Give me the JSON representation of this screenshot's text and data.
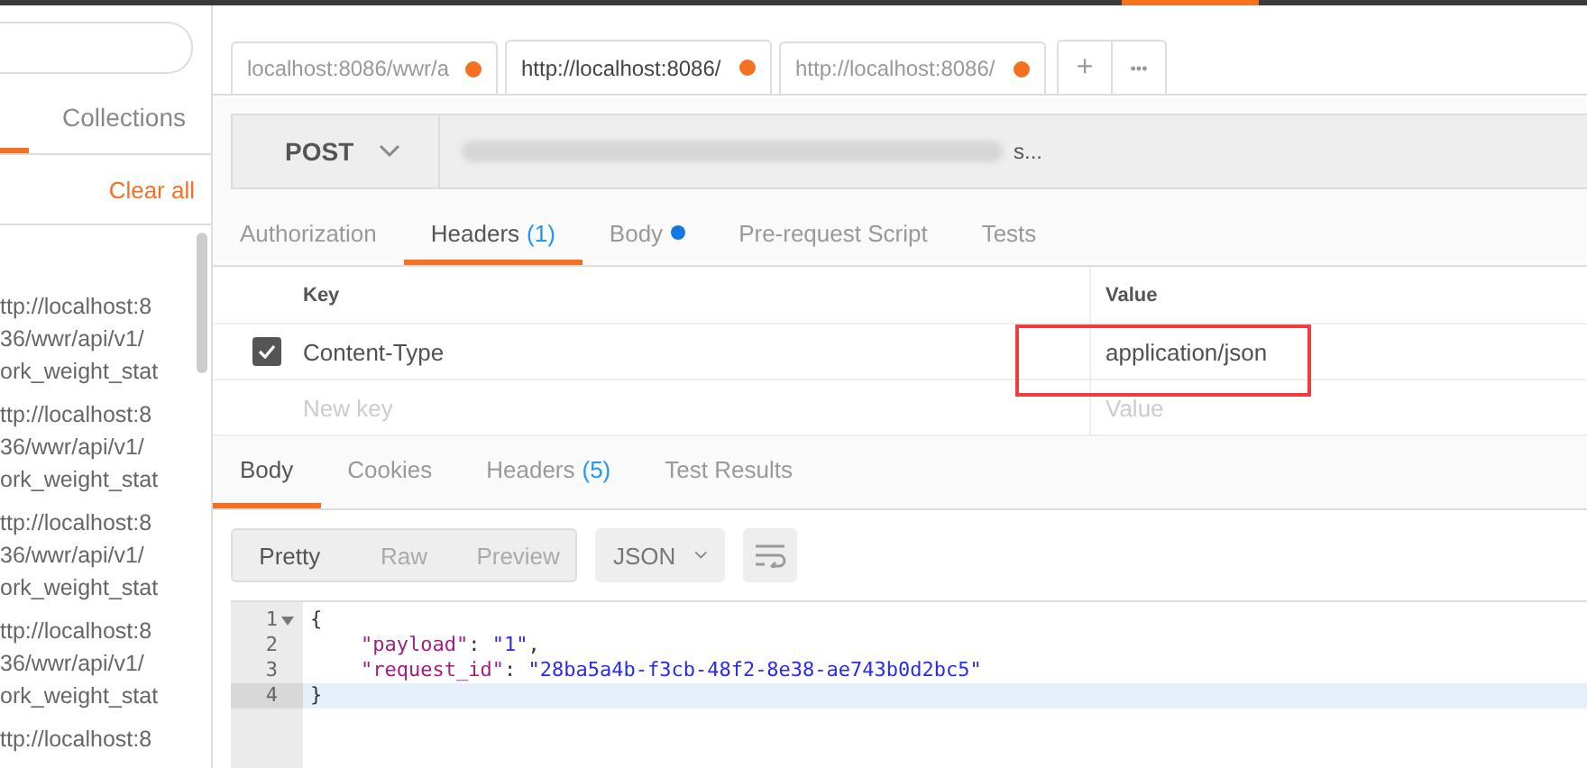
{
  "sidebar": {
    "tabs": [
      {
        "selected": true
      },
      {
        "label": "Collections",
        "selected": false
      }
    ],
    "clear_all": "Clear all",
    "history": [
      {
        "lines": [
          "ttp://localhost:8",
          "36/wwr/api/v1/",
          "ork_weight_stat"
        ]
      },
      {
        "lines": [
          "ttp://localhost:8",
          "36/wwr/api/v1/",
          "ork_weight_stat"
        ]
      },
      {
        "lines": [
          "ttp://localhost:8",
          "36/wwr/api/v1/",
          "ork_weight_stat"
        ]
      },
      {
        "lines": [
          "ttp://localhost:8",
          "36/wwr/api/v1/",
          "ork_weight_stat"
        ]
      },
      {
        "lines": [
          "ttp://localhost:8"
        ]
      }
    ]
  },
  "request_tabs": [
    {
      "label": "localhost:8086/wwr/a",
      "selected": false,
      "unsaved": true
    },
    {
      "label": "http://localhost:8086/",
      "selected": true,
      "unsaved": true
    },
    {
      "label": "http://localhost:8086/",
      "selected": false,
      "unsaved": true
    }
  ],
  "new_tab": "+",
  "more": "•••",
  "request": {
    "method": "POST",
    "url_tail": "s..."
  },
  "request_sections": [
    {
      "label": "Authorization",
      "selected": false,
      "dot": false
    },
    {
      "label": "Headers",
      "selected": true,
      "count": "(1)",
      "dot": false
    },
    {
      "label": "Body",
      "selected": false,
      "dot": true
    },
    {
      "label": "Pre-request Script",
      "selected": false,
      "dot": false
    },
    {
      "label": "Tests",
      "selected": false,
      "dot": false
    }
  ],
  "headers": {
    "columns": [
      "Key",
      "Value"
    ],
    "rows": [
      {
        "checked": true,
        "key": "Content-Type",
        "value": "application/json",
        "highlighted": true
      }
    ],
    "new_key": "New key",
    "new_value": "Value"
  },
  "response_tabs": [
    {
      "label": "Body",
      "selected": true
    },
    {
      "label": "Cookies",
      "selected": false
    },
    {
      "label": "Headers",
      "selected": false,
      "count": "(5)"
    },
    {
      "label": "Test Results",
      "selected": false
    }
  ],
  "views": [
    {
      "label": "Pretty",
      "selected": true
    },
    {
      "label": "Raw",
      "selected": false
    },
    {
      "label": "Preview",
      "selected": false
    }
  ],
  "format": "JSON",
  "code": [
    {
      "number": "1",
      "foldable": true,
      "current": false,
      "indented": false,
      "tokens": [
        {
          "kind": "punct",
          "text": "{"
        }
      ]
    },
    {
      "number": "2",
      "foldable": false,
      "current": false,
      "indented": true,
      "tokens": [
        {
          "kind": "key",
          "text": "\"payload\""
        },
        {
          "kind": "punct",
          "text": ": "
        },
        {
          "kind": "string",
          "text": "\"1\""
        },
        {
          "kind": "punct",
          "text": ","
        }
      ]
    },
    {
      "number": "3",
      "foldable": false,
      "current": false,
      "indented": true,
      "tokens": [
        {
          "kind": "key",
          "text": "\"request_id\""
        },
        {
          "kind": "punct",
          "text": ": "
        },
        {
          "kind": "string",
          "text": "\"28ba5a4b-f3cb-48f2-8e38-ae743b0d2bc5\""
        }
      ]
    },
    {
      "number": "4",
      "foldable": false,
      "current": true,
      "indented": false,
      "tokens": [
        {
          "kind": "punct",
          "text": "}"
        }
      ]
    }
  ]
}
